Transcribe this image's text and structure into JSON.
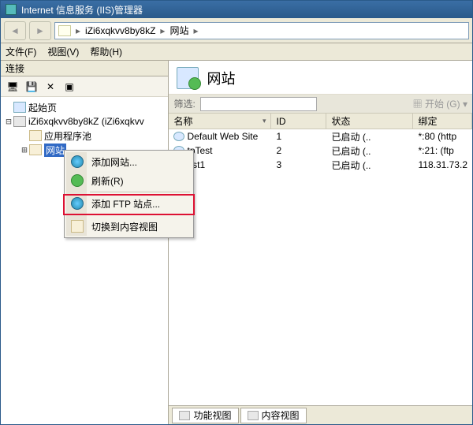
{
  "window_title": "Internet 信息服务 (IIS)管理器",
  "breadcrumb": {
    "server": "iZi6xqkvv8by8kZ",
    "node": "网站"
  },
  "menus": {
    "file": "文件(F)",
    "view": "视图(V)",
    "help": "帮助(H)"
  },
  "left_panel_title": "连接",
  "tree": {
    "root": "起始页",
    "server": "iZi6xqkvv8by8kZ (iZi6xqkvv",
    "apppool": "应用程序池",
    "sites": "网站"
  },
  "context_menu": {
    "add_site": "添加网站...",
    "refresh": "刷新(R)",
    "add_ftp": "添加 FTP 站点...",
    "content_view": "切换到内容视图"
  },
  "right": {
    "heading": "网站",
    "filter_label": "筛选:",
    "open_label": "开始 (G)",
    "columns": {
      "name": "名称",
      "id": "ID",
      "state": "状态",
      "binding": "绑定"
    },
    "rows": [
      {
        "name": "Default Web Site",
        "id": "1",
        "state": "已启动 (..",
        "binding": "*:80 (http"
      },
      {
        "name": "tpTest",
        "id": "2",
        "state": "已启动 (..",
        "binding": "*:21: (ftp"
      },
      {
        "name": "est1",
        "id": "3",
        "state": "已启动 (..",
        "binding": "118.31.73.2"
      }
    ]
  },
  "tabs": {
    "features": "功能视图",
    "content": "内容视图"
  }
}
